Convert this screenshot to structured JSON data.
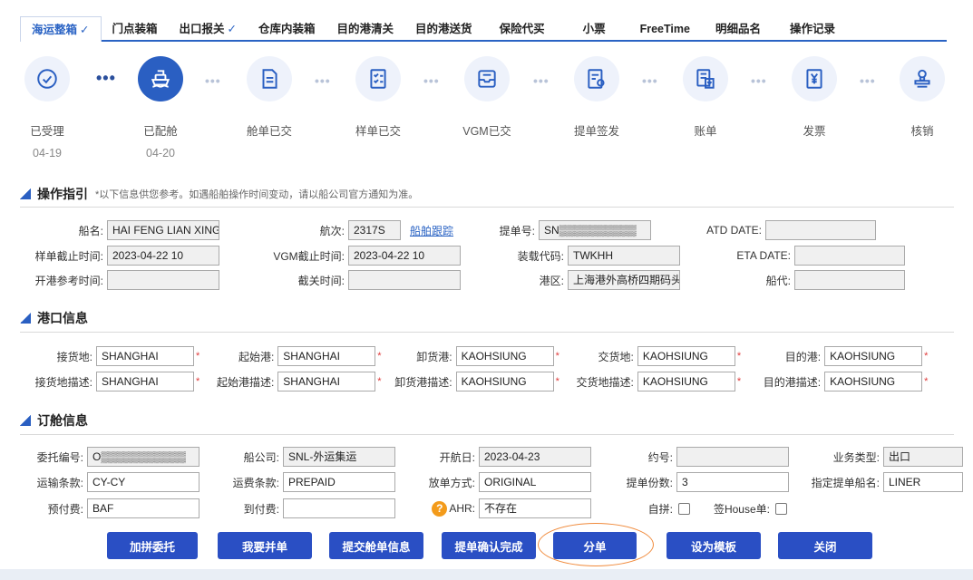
{
  "tabs": [
    {
      "label": "海运整箱",
      "checked": true,
      "active": true
    },
    {
      "label": "门点装箱",
      "checked": false
    },
    {
      "label": "出口报关",
      "checked": true
    },
    {
      "label": "仓库内装箱",
      "checked": false
    },
    {
      "label": "目的港清关",
      "checked": false
    },
    {
      "label": "目的港送货",
      "checked": false
    },
    {
      "label": "保险代买",
      "checked": false
    },
    {
      "label": "小票",
      "checked": false
    },
    {
      "label": "FreeTime",
      "checked": false
    },
    {
      "label": "明细品名",
      "checked": false
    },
    {
      "label": "操作记录",
      "checked": false
    }
  ],
  "checkmark": "✓",
  "steps": [
    {
      "label": "已受理",
      "date": "04-19",
      "icon": "check-circle-icon"
    },
    {
      "label": "已配舱",
      "date": "04-20",
      "icon": "ship-icon",
      "active": true
    },
    {
      "label": "舱单已交",
      "date": "",
      "icon": "document-icon"
    },
    {
      "label": "样单已交",
      "date": "",
      "icon": "checklist-icon"
    },
    {
      "label": "VGM已交",
      "date": "",
      "icon": "inbox-icon"
    },
    {
      "label": "提单签发",
      "date": "",
      "icon": "bill-icon"
    },
    {
      "label": "账单",
      "date": "",
      "icon": "invoice-icon"
    },
    {
      "label": "发票",
      "date": "",
      "icon": "yen-icon"
    },
    {
      "label": "核销",
      "date": "",
      "icon": "stamp-icon"
    }
  ],
  "dots": "•••",
  "colors": {
    "accent": "#2a5fc2",
    "button": "#2a4fc4",
    "required": "#e03b3b",
    "highlight": "#f08a3b"
  },
  "sections": {
    "op": {
      "title": "操作指引",
      "note": "*以下信息供您参考。如遇船舶操作时间变动，请以船公司官方通知为准。"
    },
    "port": {
      "title": "港口信息"
    },
    "booking": {
      "title": "订舱信息"
    }
  },
  "op": {
    "vessel_label": "船名:",
    "vessel": "HAI FENG LIAN XING",
    "voyage_label": "航次:",
    "voyage": "2317S",
    "track_link": "船舶跟踪",
    "bl_label": "提单号:",
    "bl": "SN▒▒▒▒▒▒▒▒▒▒",
    "atd_label": "ATD DATE:",
    "atd": "",
    "si_cutoff_label": "样单截止时间:",
    "si_cutoff": "2023-04-22 10",
    "vgm_cutoff_label": "VGM截止时间:",
    "vgm_cutoff": "2023-04-22 10",
    "loading_code_label": "装载代码:",
    "loading_code": "TWKHH",
    "eta_label": "ETA DATE:",
    "eta": "",
    "open_time_label": "开港参考时间:",
    "open_time": "",
    "customs_cutoff_label": "截关时间:",
    "customs_cutoff": "",
    "terminal_label": "港区:",
    "terminal": "上海港外高桥四期码头",
    "agent_label": "船代:",
    "agent": ""
  },
  "port": {
    "receipt_label": "接货地:",
    "receipt": "SHANGHAI",
    "pol_label": "起始港:",
    "pol": "SHANGHAI",
    "pod_label": "卸货港:",
    "pod": "KAOHSIUNG",
    "delivery_label": "交货地:",
    "delivery": "KAOHSIUNG",
    "dest_label": "目的港:",
    "dest": "KAOHSIUNG",
    "receipt_desc_label": "接货地描述:",
    "receipt_desc": "SHANGHAI",
    "pol_desc_label": "起始港描述:",
    "pol_desc": "SHANGHAI",
    "pod_desc_label": "卸货港描述:",
    "pod_desc": "KAOHSIUNG",
    "delivery_desc_label": "交货地描述:",
    "delivery_desc": "KAOHSIUNG",
    "dest_desc_label": "目的港描述:",
    "dest_desc": "KAOHSIUNG",
    "required_mark": "*"
  },
  "booking": {
    "entrust_no_label": "委托编号:",
    "entrust_no": "O▒▒▒▒▒▒▒▒▒▒▒",
    "carrier_label": "船公司:",
    "carrier": "SNL-外运集运",
    "sail_date_label": "开航日:",
    "sail_date": "2023-04-23",
    "contract_label": "约号:",
    "contract": "",
    "biz_type_label": "业务类型:",
    "biz_type": "出口",
    "transport_term_label": "运输条款:",
    "transport_term": "CY-CY",
    "freight_term_label": "运费条款:",
    "freight_term": "PREPAID",
    "release_label": "放单方式:",
    "release": "ORIGINAL",
    "bl_copies_label": "提单份数:",
    "bl_copies": "3",
    "bl_vessel_label": "指定提单船名:",
    "bl_vessel": "LINER",
    "prepaid_label": "预付费:",
    "prepaid": "BAF",
    "collect_label": "到付费:",
    "collect": "",
    "ahr_label": "AHR:",
    "ahr": "不存在",
    "self_consol_label": "自拼:",
    "house_label": "签House单:",
    "question_mark": "?"
  },
  "buttons": {
    "add_consol": "加拼委托",
    "want_consol": "我要并单",
    "submit_manifest": "提交舱单信息",
    "bl_confirm": "提单确认完成",
    "split": "分单",
    "set_template": "设为模板",
    "close": "关闭"
  }
}
